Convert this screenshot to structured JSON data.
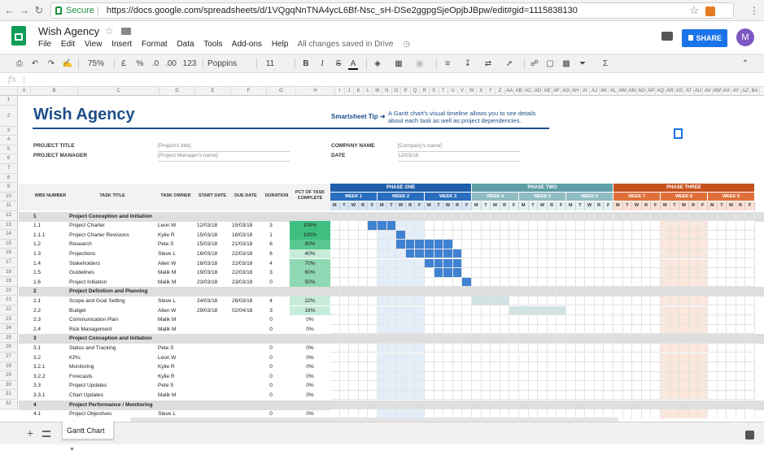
{
  "browser": {
    "secure_label": "Secure",
    "url": "https://docs.google.com/spreadsheets/d/1VQgqNnTNA4ycL6Bf-Nsc_sH-DSe2ggpgSjeOpjbJBpw/edit#gid=1115838130"
  },
  "app": {
    "title": "Wish Agency",
    "menus": [
      "File",
      "Edit",
      "View",
      "Insert",
      "Format",
      "Data",
      "Tools",
      "Add-ons",
      "Help"
    ],
    "save_status": "All changes saved in Drive",
    "share_label": "SHARE",
    "avatar_initial": "M"
  },
  "toolbar": {
    "zoom": "75%",
    "currency": "£",
    "percent": "%",
    "dec_less": ".0",
    "dec_more": ".00",
    "format_more": "123",
    "font": "Poppins",
    "font_size": "11",
    "bold": "B",
    "italic": "I",
    "underline": "A"
  },
  "formula_bar": {
    "fx": "fx"
  },
  "columns": [
    "A",
    "B",
    "C",
    "D",
    "E",
    "F",
    "G",
    "H",
    "I",
    "J",
    "K",
    "L",
    "M",
    "N",
    "O",
    "P",
    "Q",
    "R",
    "S",
    "T",
    "U",
    "V",
    "W",
    "X",
    "Y",
    "Z",
    "AA",
    "AB",
    "AC",
    "AD",
    "AE",
    "AF",
    "AG",
    "AH",
    "AI",
    "AJ",
    "AK",
    "AL",
    "AM",
    "AN",
    "AO",
    "AP",
    "AQ",
    "AR",
    "AS",
    "AT",
    "AU",
    "AV",
    "AW",
    "AX",
    "AY",
    "AZ",
    "BA"
  ],
  "rows": [
    "1",
    "2",
    "3",
    "4",
    "5",
    "6",
    "7",
    "8",
    "9",
    "10",
    "11",
    "12",
    "13",
    "14",
    "15",
    "16",
    "17",
    "18",
    "19",
    "20",
    "21",
    "22",
    "23",
    "24",
    "25",
    "26",
    "27",
    "28",
    "29",
    "30",
    "31",
    "32"
  ],
  "sheet": {
    "title": "Wish Agency",
    "tip_label": "Smartsheet Tip ➜",
    "tip_text": "A Gantt chart's visual timeline allows you to see details about each task as well as project dependencies.",
    "meta": {
      "project_title_label": "PROJECT TITLE",
      "project_title_value": "[Project's title]",
      "project_manager_label": "PROJECT MANAGER",
      "project_manager_value": "[Project Manager's name]",
      "company_name_label": "COMPANY NAME",
      "company_name_value": "[Company's name]",
      "date_label": "DATE",
      "date_value": "12/03/18"
    },
    "headers": {
      "wbs": "WBS NUMBER",
      "task": "TASK TITLE",
      "owner": "TASK OWNER",
      "start": "START DATE",
      "due": "DUE DATE",
      "duration": "DURATION",
      "pct": "PCT OF TASK COMPLETE"
    },
    "phases": [
      {
        "label": "PHASE ONE",
        "color": "#1f5ea8"
      },
      {
        "label": "PHASE TWO",
        "color": "#5f9ea6"
      },
      {
        "label": "PHASE THREE",
        "color": "#c5511d"
      }
    ],
    "weeks": [
      "WEEK 1",
      "WEEK 2",
      "WEEK 3",
      "WEEK 4",
      "WEEK 5",
      "WEEK 6",
      "WEEK 7",
      "WEEK 8",
      "WEEK 9"
    ],
    "days": [
      "M",
      "T",
      "W",
      "R",
      "F"
    ],
    "tasks": [
      {
        "wbs": "1",
        "title": "Project Conception and Initiation",
        "section": true
      },
      {
        "wbs": "1.1",
        "title": "Project Charter",
        "owner": "Leon W",
        "start": "12/03/18",
        "due": "15/03/18",
        "duration": "3",
        "pct": "100%",
        "pctv": 1.0,
        "g0": 4,
        "g1": 7
      },
      {
        "wbs": "1.1.1",
        "title": "Project Charter Revisions",
        "owner": "Kylie R",
        "start": "15/03/18",
        "due": "16/03/18",
        "duration": "1",
        "pctv": 1.0,
        "pct": "100%",
        "g0": 7,
        "g1": 8
      },
      {
        "wbs": "1.2",
        "title": "Research",
        "owner": "Pete S",
        "start": "15/03/18",
        "due": "21/03/18",
        "duration": "6",
        "pct": "90%",
        "pctv": 0.9,
        "g0": 7,
        "g1": 13
      },
      {
        "wbs": "1.3",
        "title": "Projections",
        "owner": "Steve L",
        "start": "16/03/18",
        "due": "22/03/18",
        "duration": "6",
        "pct": "40%",
        "pctv": 0.4,
        "g0": 8,
        "g1": 14
      },
      {
        "wbs": "1.4",
        "title": "Stakeholders",
        "owner": "Allen W",
        "start": "18/03/18",
        "due": "22/03/18",
        "duration": "4",
        "pct": "70%",
        "pctv": 0.7,
        "g0": 10,
        "g1": 14
      },
      {
        "wbs": "1.5",
        "title": "Guidelines",
        "owner": "Malik M",
        "start": "19/03/18",
        "due": "22/03/18",
        "duration": "3",
        "pct": "60%",
        "pctv": 0.6,
        "g0": 11,
        "g1": 14
      },
      {
        "wbs": "1.6",
        "title": "Project Initiation",
        "owner": "Malik M",
        "start": "23/03/18",
        "due": "23/03/18",
        "duration": "0",
        "pct": "50%",
        "pctv": 0.5,
        "g0": 14,
        "g1": 15
      },
      {
        "wbs": "2",
        "title": "Project Definition and Planning",
        "section": true
      },
      {
        "wbs": "2.1",
        "title": "Scope and Goal Setting",
        "owner": "Steve L",
        "start": "24/03/18",
        "due": "28/03/18",
        "duration": "4",
        "pct": "22%",
        "pctv": 0.22,
        "g0": 15,
        "g1": 19
      },
      {
        "wbs": "2.2",
        "title": "Budget",
        "owner": "Allen W",
        "start": "29/03/18",
        "due": "02/04/18",
        "duration": "3",
        "pct": "16%",
        "pctv": 0.16,
        "g0": 19,
        "g1": 25
      },
      {
        "wbs": "2.3",
        "title": "Communication Plan",
        "owner": "Malik M",
        "start": "",
        "due": "",
        "duration": "0",
        "pct": "0%",
        "pctv": 0
      },
      {
        "wbs": "2.4",
        "title": "Risk Management",
        "owner": "Malik M",
        "start": "",
        "due": "",
        "duration": "0",
        "pct": "0%",
        "pctv": 0
      },
      {
        "wbs": "3",
        "title": "Project Conception and Initiation",
        "section": true
      },
      {
        "wbs": "3.1",
        "title": "Status and Tracking",
        "owner": "Pete S",
        "start": "",
        "due": "",
        "duration": "0",
        "pct": "0%",
        "pctv": 0
      },
      {
        "wbs": "3.2",
        "title": "KPIs",
        "owner": "Leon W",
        "start": "",
        "due": "",
        "duration": "0",
        "pct": "0%",
        "pctv": 0
      },
      {
        "wbs": "3.2.1",
        "title": "Monitoring",
        "owner": "Kylie R",
        "start": "",
        "due": "",
        "duration": "0",
        "pct": "0%",
        "pctv": 0
      },
      {
        "wbs": "3.2.2",
        "title": "Forecasts",
        "owner": "Kylie R",
        "start": "",
        "due": "",
        "duration": "0",
        "pct": "0%",
        "pctv": 0
      },
      {
        "wbs": "3.3",
        "title": "Project Updates",
        "owner": "Pete S",
        "start": "",
        "due": "",
        "duration": "0",
        "pct": "0%",
        "pctv": 0
      },
      {
        "wbs": "3.3.1",
        "title": "Chart Updates",
        "owner": "Malik M",
        "start": "",
        "due": "",
        "duration": "0",
        "pct": "0%",
        "pctv": 0
      },
      {
        "wbs": "4",
        "title": "Project Performance / Monitoring",
        "section": true
      },
      {
        "wbs": "4.1",
        "title": "Project Objectives",
        "owner": "Steve L",
        "start": "",
        "due": "",
        "duration": "0",
        "pct": "0%",
        "pctv": 0
      }
    ]
  },
  "tabs": {
    "active": "Gantt Chart"
  }
}
